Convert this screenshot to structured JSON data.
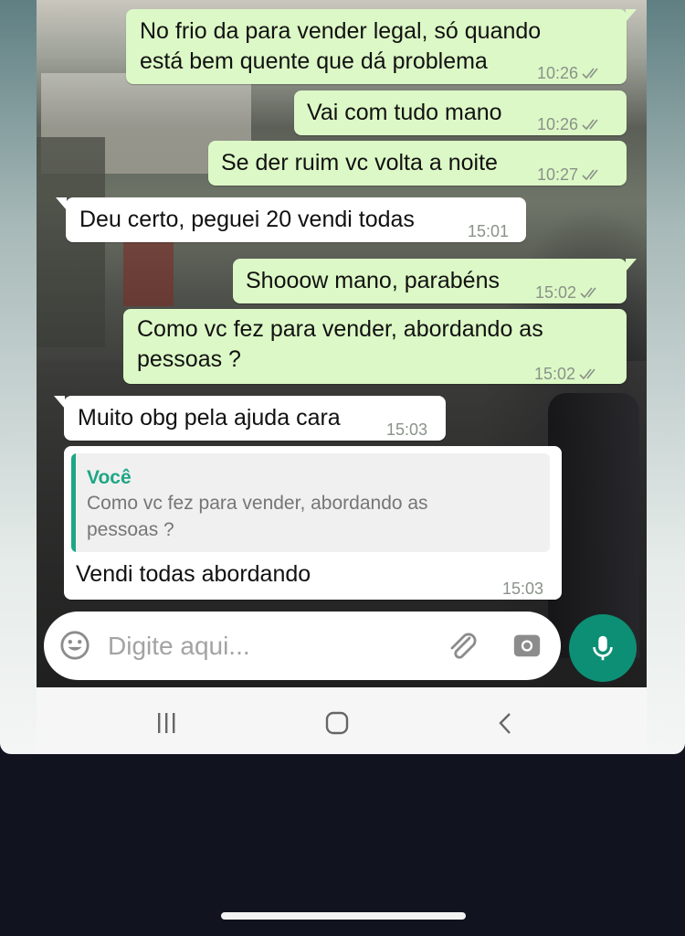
{
  "messages": [
    {
      "type": "outgoing",
      "lines": [
        "No frio da para vender legal, só quando",
        "está bem quente que dá problema"
      ],
      "time": "10:26"
    },
    {
      "type": "outgoing",
      "lines": [
        "Vai com tudo mano"
      ],
      "time": "10:26"
    },
    {
      "type": "outgoing",
      "lines": [
        "Se der ruim vc volta a noite"
      ],
      "time": "10:27"
    },
    {
      "type": "incoming",
      "lines": [
        "Deu certo, peguei 20 vendi todas"
      ],
      "time": "15:01"
    },
    {
      "type": "outgoing",
      "lines": [
        "Shooow mano, parabéns"
      ],
      "time": "15:02"
    },
    {
      "type": "outgoing",
      "lines": [
        "Como vc fez para vender, abordando as",
        "pessoas ?"
      ],
      "time": "15:02"
    },
    {
      "type": "incoming",
      "lines": [
        "Muito obg pela ajuda cara"
      ],
      "time": "15:03"
    },
    {
      "type": "incoming",
      "quote": {
        "author": "Você",
        "lines": [
          "Como vc fez para vender, abordando as",
          "pessoas ?"
        ]
      },
      "lines": [
        "Vendi todas abordando"
      ],
      "time": "15:03"
    }
  ],
  "input": {
    "placeholder": "Digite aqui..."
  },
  "icons": {
    "emoji": "emoji-icon",
    "attach": "paperclip-icon",
    "camera": "camera-icon",
    "mic": "microphone-icon",
    "recents": "recent-apps-icon",
    "home": "home-icon",
    "back": "back-icon"
  },
  "colors": {
    "outgoing_bubble": "#dcf8c6",
    "incoming_bubble": "#ffffff",
    "accent": "#0d8f75",
    "quote_accent": "#1ea685",
    "read_ticks": "#8a9289"
  }
}
